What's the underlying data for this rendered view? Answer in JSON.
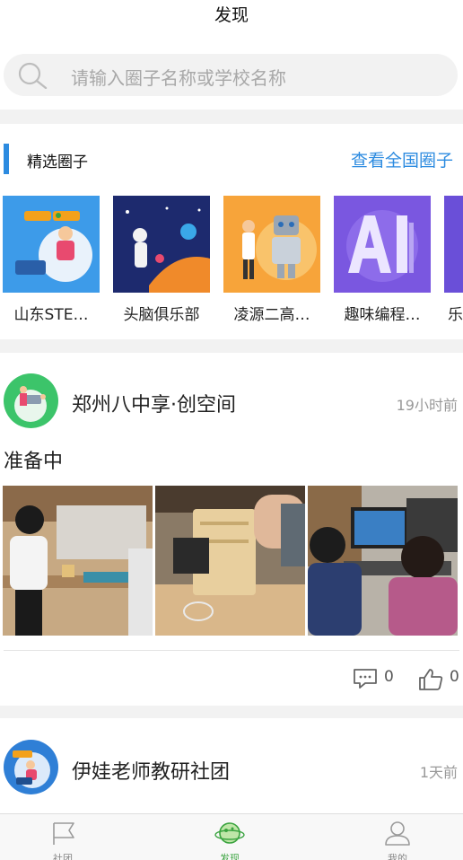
{
  "header": {
    "title": "发现"
  },
  "search": {
    "placeholder": "请输入圈子名称或学校名称"
  },
  "featured": {
    "title": "精选圈子",
    "view_all": "查看全国圈子",
    "items": [
      {
        "label": "山东STE…"
      },
      {
        "label": "头脑俱乐部"
      },
      {
        "label": "凌源二高…"
      },
      {
        "label": "趣味编程…"
      },
      {
        "label": "乐"
      }
    ]
  },
  "posts": [
    {
      "name": "郑州八中享·创空间",
      "time": "19小时前",
      "text": "准备中",
      "comments": "0",
      "likes": "0"
    },
    {
      "name": "伊娃老师教研社团",
      "time": "1天前"
    }
  ],
  "tabbar": {
    "items": [
      {
        "label": "社团",
        "icon": "flag-icon"
      },
      {
        "label": "发现",
        "icon": "planet-icon"
      },
      {
        "label": "我的",
        "icon": "person-icon"
      }
    ],
    "active_color": "#3aa33f"
  },
  "colors": {
    "accent": "#2c8be0"
  }
}
